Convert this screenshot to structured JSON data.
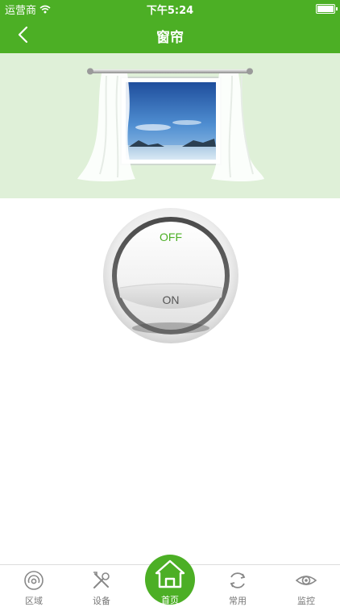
{
  "status_bar": {
    "carrier": "运营商",
    "time": "下午5:24"
  },
  "header": {
    "title": "窗帘"
  },
  "switch": {
    "off_label": "OFF",
    "on_label": "ON"
  },
  "tabs": [
    {
      "label": "区域",
      "icon": "area-icon"
    },
    {
      "label": "设备",
      "icon": "tools-icon"
    },
    {
      "label": "首页",
      "icon": "home-icon"
    },
    {
      "label": "常用",
      "icon": "refresh-icon"
    },
    {
      "label": "监控",
      "icon": "eye-icon"
    }
  ],
  "colors": {
    "brand": "#4caf25",
    "hero_bg": "#dff0d8",
    "off_text": "#4caf25"
  }
}
